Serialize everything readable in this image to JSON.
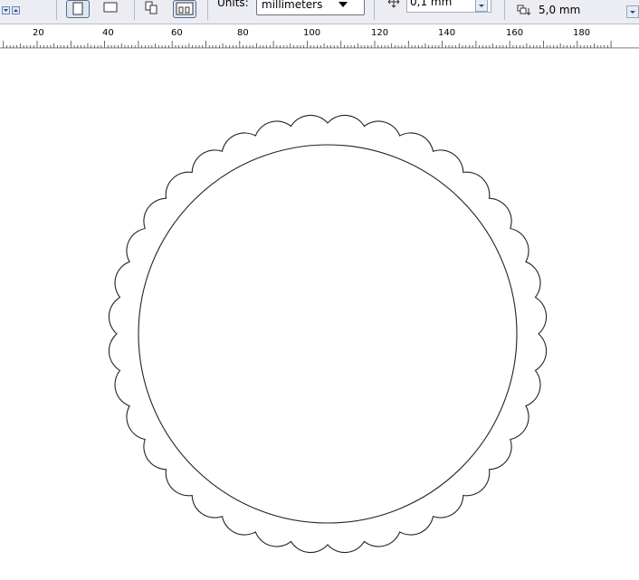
{
  "toolbar": {
    "units_label": "Units:",
    "units_value": "millimeters",
    "nudge_value": "0,1 mm",
    "duplicate_distance_value": "5,0 mm"
  },
  "ruler": {
    "labels": [
      "20",
      "40",
      "60",
      "80",
      "100",
      "120",
      "140",
      "160",
      "180"
    ]
  },
  "drawing": {
    "stroke_color": "#222222",
    "scallop_count": 36
  }
}
